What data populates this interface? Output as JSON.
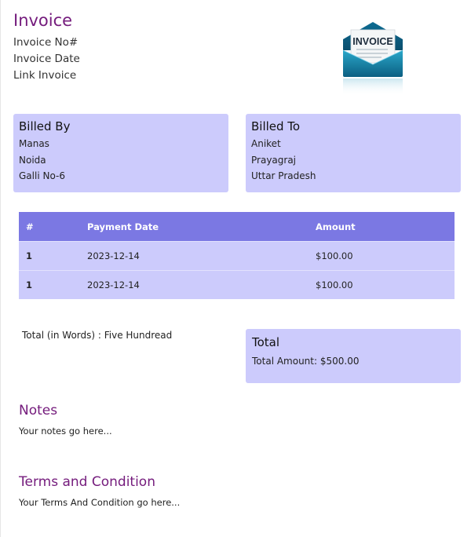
{
  "header": {
    "title": "Invoice",
    "invoice_no_label": "Invoice No#",
    "invoice_date_label": "Invoice Date",
    "link_invoice_label": "Link Invoice",
    "logo_text": "INVOICE"
  },
  "billed_by": {
    "title": "Billed By",
    "lines": [
      "Manas",
      "Noida",
      "Galli No-6"
    ]
  },
  "billed_to": {
    "title": "Billed To",
    "lines": [
      "Aniket",
      "Prayagraj",
      "Uttar Pradesh"
    ]
  },
  "table": {
    "headers": [
      "#",
      "Payment Date",
      "Amount"
    ],
    "rows": [
      [
        "1",
        "2023-12-14",
        "$100.00"
      ],
      [
        "1",
        "2023-12-14",
        "$100.00"
      ]
    ]
  },
  "totals": {
    "words": "Total (in Words) : Five Hundread",
    "title": "Total",
    "amount": "Total Amount: $500.00"
  },
  "notes": {
    "title": "Notes",
    "text": "Your notes go here..."
  },
  "terms": {
    "title": "Terms and Condition",
    "text": "Your Terms And Condition go here..."
  },
  "colors": {
    "accent": "#741b7c",
    "card_bg": "#cccbfc",
    "table_header_bg": "#7b78e3"
  },
  "icons": {
    "logo": "invoice-envelope-icon"
  }
}
